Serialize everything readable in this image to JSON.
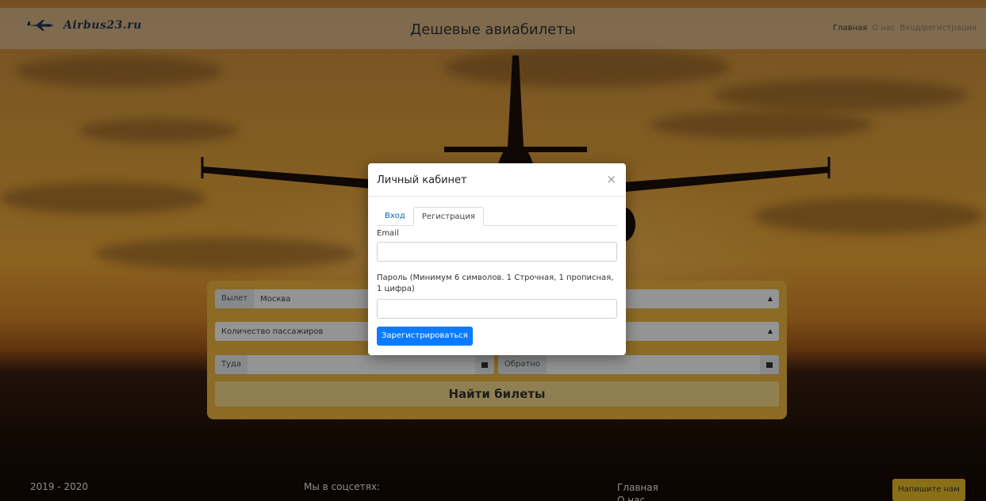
{
  "header": {
    "logo_text": "Airbus23.ru",
    "title": "Дешевые авиабилеты",
    "nav": [
      "Главная",
      "О нас",
      "Вход/регистрация"
    ]
  },
  "search": {
    "departure_prefix": "Вылет",
    "departure_value": "Москва",
    "passengers_placeholder": "Количество пассажиров",
    "there_prefix": "Туда",
    "back_prefix": "Обратно",
    "find_button": "Найти билеты"
  },
  "modal": {
    "title": "Личный кабинет",
    "close": "×",
    "tabs": [
      "Вход",
      "Регистрация"
    ],
    "active_tab": "Регистрация",
    "email_label": "Email",
    "password_label": "Пароль (Минимум 6 символов. 1 Строчная, 1 прописная, 1 цифра)",
    "register_button": "Зарегистрироваться"
  },
  "footer": {
    "years": "2019 - 2020",
    "social": "Мы в соцсетях:",
    "links": [
      "Главная",
      "О нас"
    ],
    "write_button": "Напишите нам"
  },
  "colors": {
    "accent_yellow": "#f0b942",
    "primary_blue": "#0a7bff",
    "link_blue": "#0a62c8"
  }
}
